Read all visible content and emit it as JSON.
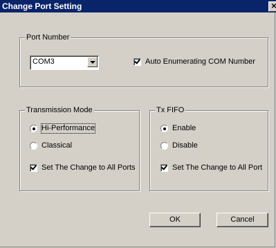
{
  "dialog": {
    "title": "Change Port Setting",
    "close_glyph": "✕"
  },
  "port_number": {
    "legend": "Port Number",
    "combo_value": "COM3",
    "auto_enum_label": "Auto Enumerating COM Number",
    "auto_enum_checked": true
  },
  "transmission_mode": {
    "legend": "Transmission Mode",
    "options": [
      "Hi-Performance",
      "Classical"
    ],
    "selected": "Hi-Performance",
    "apply_all_label": "Set The Change to All Ports",
    "apply_all_checked": true
  },
  "tx_fifo": {
    "legend": "Tx FIFO",
    "options": [
      "Enable",
      "Disable"
    ],
    "selected": "Enable",
    "apply_all_label": "Set The Change to All Port",
    "apply_all_checked": true
  },
  "buttons": {
    "ok": "OK",
    "cancel": "Cancel"
  }
}
